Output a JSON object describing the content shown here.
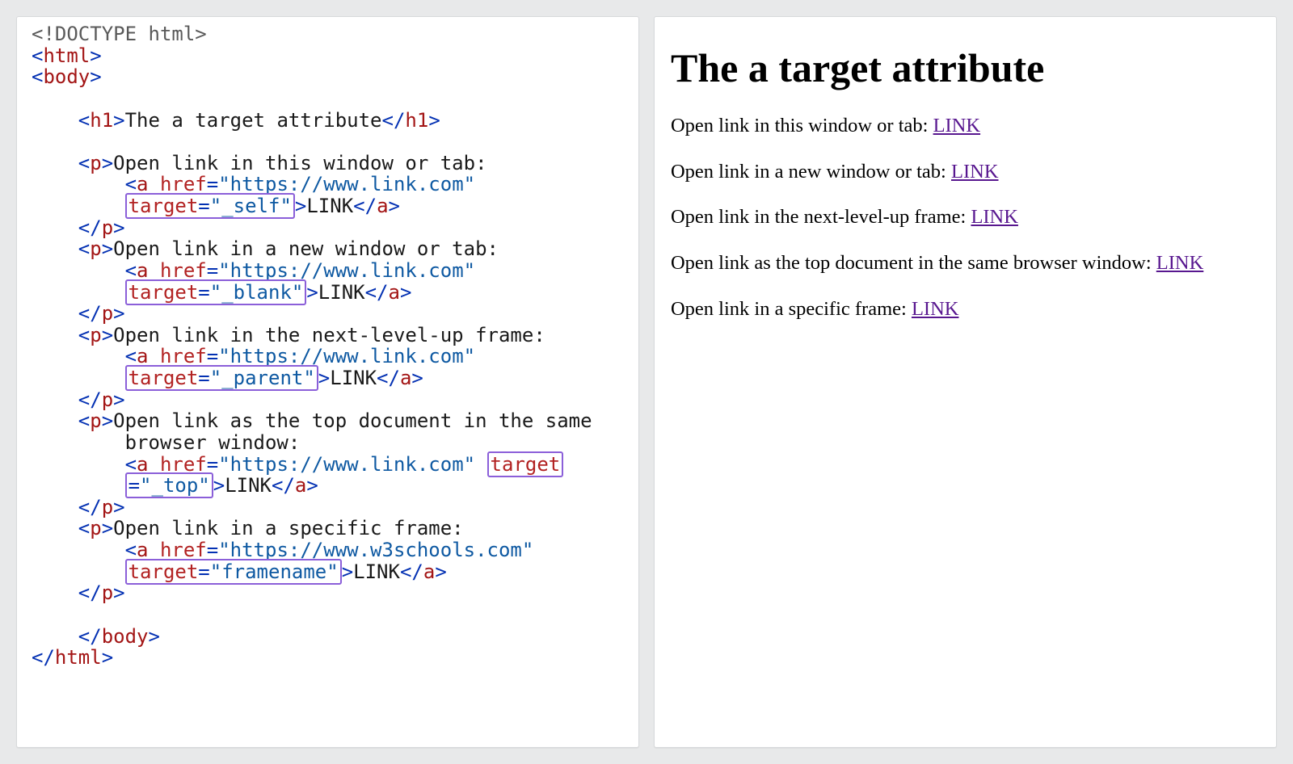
{
  "code": {
    "doctype": "<!DOCTYPE html>",
    "tag_html": "html",
    "tag_body": "body",
    "tag_h1": "h1",
    "h1_text": "The a target attribute",
    "tag_p": "p",
    "tag_a": "a",
    "attr_href": "href",
    "attr_target": "target",
    "eq": "=",
    "link_text": "LINK",
    "items": [
      {
        "desc": "Open link in this window or tab:",
        "href": "\"https://www.link.com\"",
        "target": "\"_self\"",
        "wrap": false
      },
      {
        "desc": "Open link in a new window or tab:",
        "href": "\"https://www.link.com\"",
        "target": "\"_blank\"",
        "wrap": false
      },
      {
        "desc": "Open link in the next-level-up frame:",
        "href": "\"https://www.link.com\"",
        "target": "\"_parent\"",
        "wrap": false
      },
      {
        "desc": "Open link as the top document in the same",
        "desc2": "browser window:",
        "href": "\"https://www.link.com\"",
        "target_a": "target",
        "target_b": "=\"_top\"",
        "wrap": true
      },
      {
        "desc": "Open link in a specific frame:",
        "href": "\"https://www.w3schools.com\"",
        "target": "\"framename\"",
        "wrap": false
      }
    ]
  },
  "preview": {
    "heading": "The a target attribute",
    "link_label": "LINK",
    "paragraphs": [
      "Open link in this window or tab: ",
      "Open link in a new window or tab: ",
      "Open link in the next-level-up frame: ",
      "Open link as the top document in the same browser window: ",
      "Open link in a specific frame: "
    ]
  }
}
